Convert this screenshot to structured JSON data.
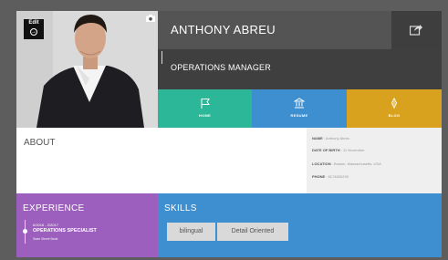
{
  "edit": {
    "label": "Edit"
  },
  "profile": {
    "name": "ANTHONY ABREU",
    "title": "OPERATIONS MANAGER"
  },
  "nav": [
    {
      "label": "HOME",
      "icon": "flag-icon",
      "color": "#2bb798"
    },
    {
      "label": "RESUME",
      "icon": "bank-icon",
      "color": "#3d8fd0"
    },
    {
      "label": "BLOG",
      "icon": "pen-icon",
      "color": "#d8a21e"
    }
  ],
  "about": {
    "heading": "ABOUT",
    "info": [
      {
        "label": "NAME",
        "value": "Anthony Abreu"
      },
      {
        "label": "DATE OF BIRTH",
        "value": "11 November"
      },
      {
        "label": "LOCATION",
        "value": "Boston, Massachusetts, USA"
      },
      {
        "label": "PHONE",
        "value": "6174800239"
      }
    ]
  },
  "experience": {
    "heading": "EXPERIENCE",
    "items": [
      {
        "dates": "6/2016 - 2/2017",
        "role": "OPERATIONS SPECIALIST",
        "org": "State Street Bank"
      }
    ]
  },
  "skills": {
    "heading": "SKILLS",
    "items": [
      "bilingual",
      "Detail Oriented"
    ]
  },
  "colors": {
    "home": "#2bb798",
    "resume": "#3d8fd0",
    "blog": "#d8a21e",
    "experience": "#9c5fbd"
  }
}
